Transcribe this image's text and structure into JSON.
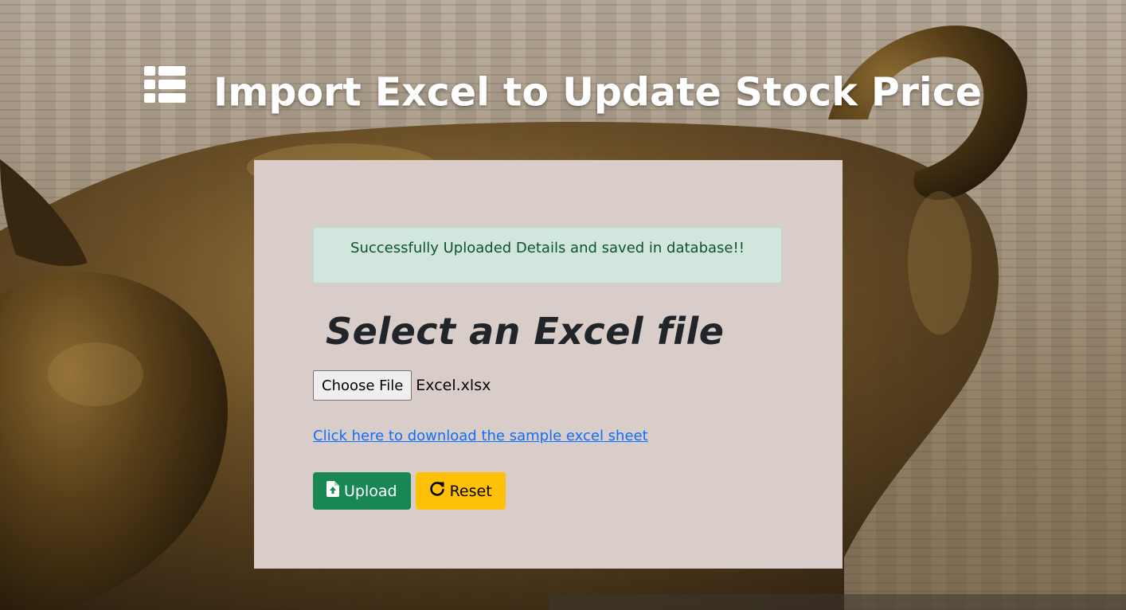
{
  "header": {
    "title": "Import Excel to Update Stock Price",
    "icon": "list-icon"
  },
  "alert": {
    "message": "Successfully Uploaded Details and saved in database!!",
    "background": "#d1e7dd",
    "text_color": "#0f5132"
  },
  "form": {
    "heading": "Select an Excel file",
    "choose_file_label": "Choose File",
    "file_name": "Excel.xlsx",
    "sample_link": "Click here to download the sample excel sheet"
  },
  "buttons": {
    "upload_label": "Upload",
    "upload_icon": "file-upload-icon",
    "upload_color": "#198754",
    "reset_label": "Reset",
    "reset_icon": "reset-icon",
    "reset_color": "#ffc107"
  }
}
